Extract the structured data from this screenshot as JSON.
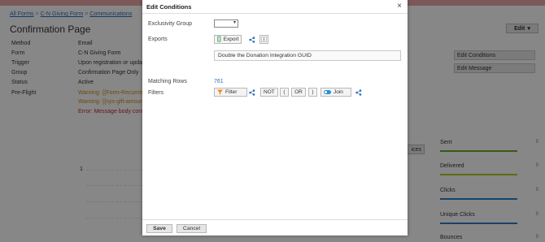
{
  "breadcrumb": {
    "items": [
      "All Forms",
      "C-N Giving Form",
      "Communications"
    ],
    "separator": ">"
  },
  "page": {
    "title": "Confirmation Page",
    "edit_menu_label": "Edit"
  },
  "details": [
    {
      "label": "Method",
      "value": "Email",
      "kind": "normal"
    },
    {
      "label": "Form",
      "value": "C-N Giving Form",
      "kind": "normal"
    },
    {
      "label": "Trigger",
      "value": "Upon registration or update",
      "kind": "normal"
    },
    {
      "label": "Group",
      "value": "Confirmation Page Only",
      "kind": "normal"
    },
    {
      "label": "Status",
      "value": "Active",
      "kind": "normal"
    },
    {
      "label": "Pre-Flight",
      "value": "Warning: {{Form-Recurring",
      "kind": "warn"
    },
    {
      "label": "",
      "value": "Warning: {{sys-gift-amount",
      "kind": "warn"
    },
    {
      "label": "",
      "value": "Error: Message body contai",
      "kind": "err"
    }
  ],
  "side_buttons": {
    "edit_conditions": "Edit Conditions",
    "edit_message": "Edit Message",
    "choices_partial": "ices"
  },
  "chart": {
    "axis_label": "1"
  },
  "stats": [
    {
      "label": "Sent",
      "value": "0",
      "color": "#6aa82a"
    },
    {
      "label": "Delivered",
      "value": "0",
      "color": "#b7c62a"
    },
    {
      "label": "Clicks",
      "value": "0",
      "color": "#2a7fc6"
    },
    {
      "label": "Unique Clicks",
      "value": "0",
      "color": "#2a7fc6"
    },
    {
      "label": "Bounces",
      "value": "0",
      "color": "#2a7fc6"
    }
  ],
  "modal": {
    "title": "Edit Conditions",
    "close_glyph": "×",
    "exclusivity_label": "Exclusivity Group",
    "exclusivity_value": "",
    "exports_label": "Exports",
    "export_chip_label": "Export",
    "guid_value": "Double the Donation Integration GUID",
    "matching_rows_label": "Matching Rows",
    "matching_rows_value": "761",
    "filters_label": "Filters",
    "filter_chip_label": "Filter",
    "not_label": "NOT",
    "open_paren": "(",
    "or_label": "OR",
    "close_paren": ")",
    "join_chip_label": "Join",
    "save_label": "Save",
    "cancel_label": "Cancel"
  },
  "icons": {
    "export": "bracket-export-icon",
    "share": "share-icon",
    "fields": "fields-icon",
    "filter": "funnel-icon",
    "join": "join-toggle-icon",
    "caret": "chevron-down-icon"
  },
  "colors": {
    "link": "#2a6ebb",
    "warning": "#d28a16",
    "error": "#c62828",
    "filter_accent": "#e8890c",
    "join_accent": "#2a8fd6",
    "top_strip": "#e9a8a8"
  }
}
